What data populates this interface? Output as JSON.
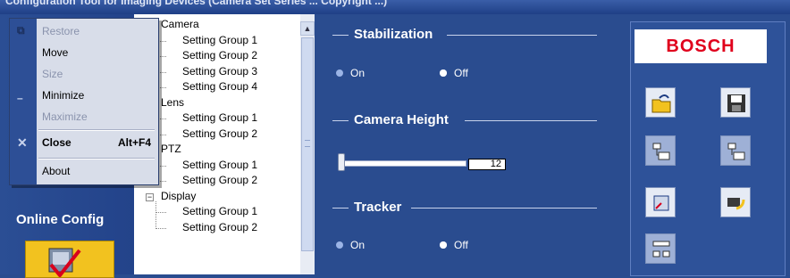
{
  "window": {
    "title": "Configuration Tool for Imaging Devices (Camera Set Series ... Copyright ...)"
  },
  "system_menu": {
    "items": [
      {
        "label": "Restore",
        "enabled": false,
        "icon": "restore-icon"
      },
      {
        "label": "Move",
        "enabled": true
      },
      {
        "label": "Size",
        "enabled": false
      },
      {
        "label": "Minimize",
        "enabled": true,
        "icon": "minimize-icon"
      },
      {
        "label": "Maximize",
        "enabled": false
      },
      {
        "label": "Close",
        "enabled": true,
        "accel": "Alt+F4",
        "icon": "close-icon"
      },
      {
        "label": "About",
        "enabled": true
      }
    ]
  },
  "left_panel": {
    "online_config_label": "Online Config"
  },
  "tree": {
    "groups": [
      {
        "label": "Camera",
        "children": [
          "Setting Group 1",
          "Setting Group 2",
          "Setting Group 3",
          "Setting Group 4"
        ]
      },
      {
        "label": "Lens",
        "children": [
          "Setting Group 1",
          "Setting Group 2"
        ]
      },
      {
        "label": "PTZ",
        "children": [
          "Setting Group 1",
          "Setting Group 2"
        ]
      },
      {
        "label": "Display",
        "expander": "−",
        "children": [
          "Setting Group 1",
          "Setting Group 2"
        ]
      }
    ]
  },
  "settings": {
    "stabilization": {
      "title": "Stabilization",
      "on_label": "On",
      "off_label": "Off",
      "selected": "Off"
    },
    "camera_height": {
      "title": "Camera Height",
      "value": "12"
    },
    "tracker": {
      "title": "Tracker",
      "on_label": "On",
      "off_label": "Off",
      "selected": "Off"
    }
  },
  "brand": {
    "logo_text": "BOSCH"
  },
  "toolbar": {
    "buttons": [
      {
        "name": "open-file-button",
        "icon": "open-folder-icon"
      },
      {
        "name": "save-button",
        "icon": "floppy-disk-icon"
      },
      {
        "name": "download-from-camera-button",
        "icon": "download-icon"
      },
      {
        "name": "upload-to-camera-button",
        "icon": "upload-icon"
      },
      {
        "name": "export-button",
        "icon": "export-icon"
      },
      {
        "name": "import-button",
        "icon": "import-icon"
      },
      {
        "name": "transfer-button",
        "icon": "transfer-icon"
      }
    ]
  },
  "colors": {
    "panel_bg": "#2a4c8f",
    "logo_red": "#e0001c",
    "menu_bg": "#d8dde9"
  }
}
